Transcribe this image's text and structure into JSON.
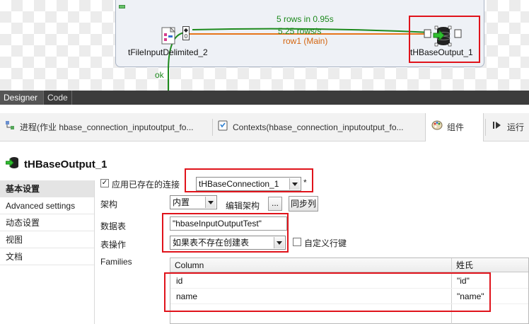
{
  "canvas": {
    "input_node_label": "tFileInputDelimited_2",
    "output_node_label": "tHBaseOutput_1",
    "stat_rows": "5 rows in 0.95s",
    "stat_rate": "5.25 rows/s",
    "link_label": "row1 (Main)",
    "ok_label": "ok"
  },
  "view_tabs": [
    "Designer",
    "Code"
  ],
  "tabs": [
    {
      "label": "进程(作业 hbase_connection_inputoutput_fo...",
      "icon": "job-icon"
    },
    {
      "label": "Contexts(hbase_connection_inputoutput_fo...",
      "icon": "contexts-icon"
    },
    {
      "label": "组件",
      "icon": "palette-icon"
    },
    {
      "label": "运行",
      "icon": "run-icon"
    }
  ],
  "component": {
    "title": "tHBaseOutput_1"
  },
  "sections": [
    "基本设置",
    "Advanced settings",
    "动态设置",
    "视图",
    "文档"
  ],
  "form": {
    "use_existing_label": "应用已存在的连接",
    "use_existing_checked": true,
    "connection_value": "tHBaseConnection_1",
    "required_mark": "*",
    "schema_label": "架构",
    "schema_value": "内置",
    "edit_schema_label": "编辑架构",
    "ellipsis_label": "...",
    "sync_columns_label": "同步列",
    "table_label": "数据表",
    "table_value": "\"hbaseInputOutputTest\"",
    "table_action_label": "表操作",
    "table_action_value": "如果表不存在创建表",
    "custom_rowkey_label": "自定义行键",
    "custom_rowkey_checked": false,
    "families_label": "Families"
  },
  "families_table": {
    "headers": [
      "Column",
      "姓氏"
    ],
    "rows": [
      [
        "id",
        "\"id\""
      ],
      [
        "name",
        "\"name\""
      ]
    ]
  },
  "colors": {
    "highlight": "#e0131b",
    "flow_green": "#1d8a1d",
    "flow_orange": "#d4650f"
  }
}
